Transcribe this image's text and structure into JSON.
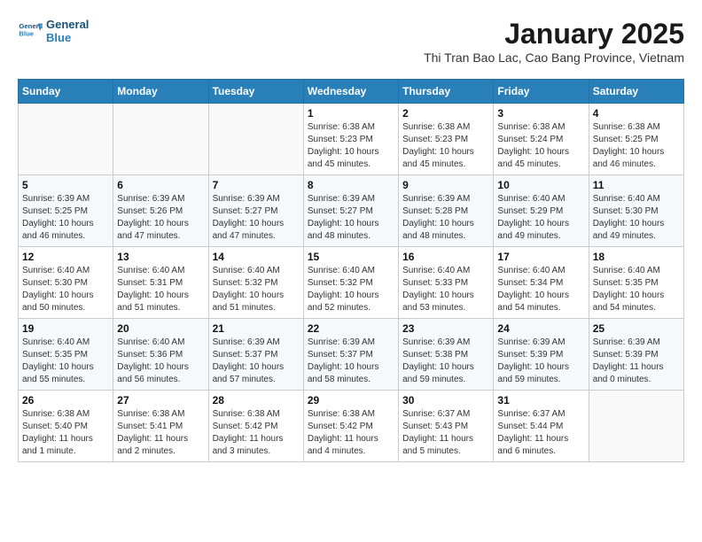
{
  "header": {
    "logo_line1": "General",
    "logo_line2": "Blue",
    "title": "January 2025",
    "subtitle": "Thi Tran Bao Lac, Cao Bang Province, Vietnam"
  },
  "weekdays": [
    "Sunday",
    "Monday",
    "Tuesday",
    "Wednesday",
    "Thursday",
    "Friday",
    "Saturday"
  ],
  "weeks": [
    [
      {
        "day": "",
        "info": ""
      },
      {
        "day": "",
        "info": ""
      },
      {
        "day": "",
        "info": ""
      },
      {
        "day": "1",
        "info": "Sunrise: 6:38 AM\nSunset: 5:23 PM\nDaylight: 10 hours\nand 45 minutes."
      },
      {
        "day": "2",
        "info": "Sunrise: 6:38 AM\nSunset: 5:23 PM\nDaylight: 10 hours\nand 45 minutes."
      },
      {
        "day": "3",
        "info": "Sunrise: 6:38 AM\nSunset: 5:24 PM\nDaylight: 10 hours\nand 45 minutes."
      },
      {
        "day": "4",
        "info": "Sunrise: 6:38 AM\nSunset: 5:25 PM\nDaylight: 10 hours\nand 46 minutes."
      }
    ],
    [
      {
        "day": "5",
        "info": "Sunrise: 6:39 AM\nSunset: 5:25 PM\nDaylight: 10 hours\nand 46 minutes."
      },
      {
        "day": "6",
        "info": "Sunrise: 6:39 AM\nSunset: 5:26 PM\nDaylight: 10 hours\nand 47 minutes."
      },
      {
        "day": "7",
        "info": "Sunrise: 6:39 AM\nSunset: 5:27 PM\nDaylight: 10 hours\nand 47 minutes."
      },
      {
        "day": "8",
        "info": "Sunrise: 6:39 AM\nSunset: 5:27 PM\nDaylight: 10 hours\nand 48 minutes."
      },
      {
        "day": "9",
        "info": "Sunrise: 6:39 AM\nSunset: 5:28 PM\nDaylight: 10 hours\nand 48 minutes."
      },
      {
        "day": "10",
        "info": "Sunrise: 6:40 AM\nSunset: 5:29 PM\nDaylight: 10 hours\nand 49 minutes."
      },
      {
        "day": "11",
        "info": "Sunrise: 6:40 AM\nSunset: 5:30 PM\nDaylight: 10 hours\nand 49 minutes."
      }
    ],
    [
      {
        "day": "12",
        "info": "Sunrise: 6:40 AM\nSunset: 5:30 PM\nDaylight: 10 hours\nand 50 minutes."
      },
      {
        "day": "13",
        "info": "Sunrise: 6:40 AM\nSunset: 5:31 PM\nDaylight: 10 hours\nand 51 minutes."
      },
      {
        "day": "14",
        "info": "Sunrise: 6:40 AM\nSunset: 5:32 PM\nDaylight: 10 hours\nand 51 minutes."
      },
      {
        "day": "15",
        "info": "Sunrise: 6:40 AM\nSunset: 5:32 PM\nDaylight: 10 hours\nand 52 minutes."
      },
      {
        "day": "16",
        "info": "Sunrise: 6:40 AM\nSunset: 5:33 PM\nDaylight: 10 hours\nand 53 minutes."
      },
      {
        "day": "17",
        "info": "Sunrise: 6:40 AM\nSunset: 5:34 PM\nDaylight: 10 hours\nand 54 minutes."
      },
      {
        "day": "18",
        "info": "Sunrise: 6:40 AM\nSunset: 5:35 PM\nDaylight: 10 hours\nand 54 minutes."
      }
    ],
    [
      {
        "day": "19",
        "info": "Sunrise: 6:40 AM\nSunset: 5:35 PM\nDaylight: 10 hours\nand 55 minutes."
      },
      {
        "day": "20",
        "info": "Sunrise: 6:40 AM\nSunset: 5:36 PM\nDaylight: 10 hours\nand 56 minutes."
      },
      {
        "day": "21",
        "info": "Sunrise: 6:39 AM\nSunset: 5:37 PM\nDaylight: 10 hours\nand 57 minutes."
      },
      {
        "day": "22",
        "info": "Sunrise: 6:39 AM\nSunset: 5:37 PM\nDaylight: 10 hours\nand 58 minutes."
      },
      {
        "day": "23",
        "info": "Sunrise: 6:39 AM\nSunset: 5:38 PM\nDaylight: 10 hours\nand 59 minutes."
      },
      {
        "day": "24",
        "info": "Sunrise: 6:39 AM\nSunset: 5:39 PM\nDaylight: 10 hours\nand 59 minutes."
      },
      {
        "day": "25",
        "info": "Sunrise: 6:39 AM\nSunset: 5:39 PM\nDaylight: 11 hours\nand 0 minutes."
      }
    ],
    [
      {
        "day": "26",
        "info": "Sunrise: 6:38 AM\nSunset: 5:40 PM\nDaylight: 11 hours\nand 1 minute."
      },
      {
        "day": "27",
        "info": "Sunrise: 6:38 AM\nSunset: 5:41 PM\nDaylight: 11 hours\nand 2 minutes."
      },
      {
        "day": "28",
        "info": "Sunrise: 6:38 AM\nSunset: 5:42 PM\nDaylight: 11 hours\nand 3 minutes."
      },
      {
        "day": "29",
        "info": "Sunrise: 6:38 AM\nSunset: 5:42 PM\nDaylight: 11 hours\nand 4 minutes."
      },
      {
        "day": "30",
        "info": "Sunrise: 6:37 AM\nSunset: 5:43 PM\nDaylight: 11 hours\nand 5 minutes."
      },
      {
        "day": "31",
        "info": "Sunrise: 6:37 AM\nSunset: 5:44 PM\nDaylight: 11 hours\nand 6 minutes."
      },
      {
        "day": "",
        "info": ""
      }
    ]
  ]
}
